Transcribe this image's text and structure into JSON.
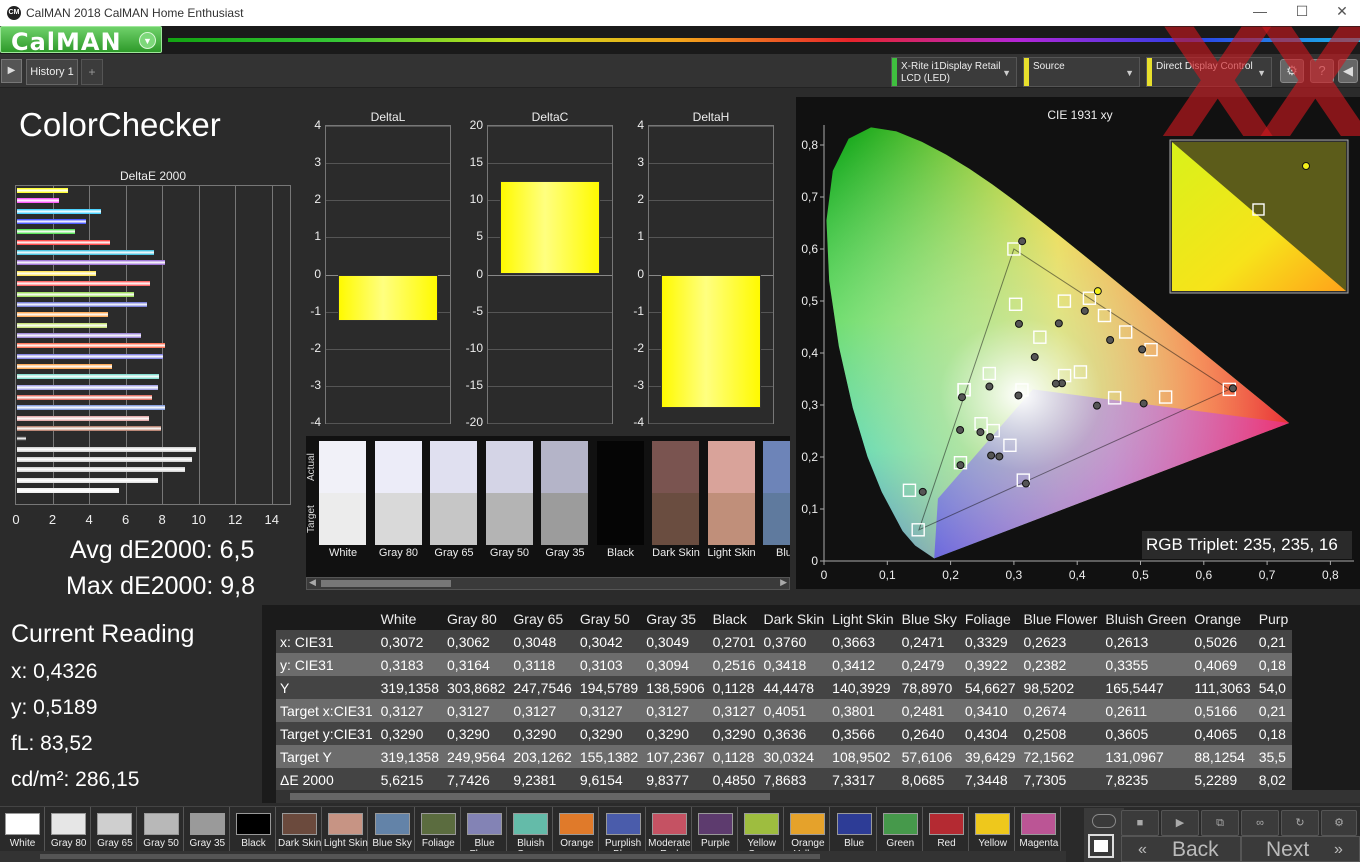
{
  "app": {
    "title": "CalMAN 2018 CalMAN Home Enthusiast",
    "logo": "CalMAN",
    "icon_text": "CM",
    "window_controls": [
      "—",
      "☐",
      "✕"
    ],
    "logo_dropdown_icon": "chevron-down-icon"
  },
  "tabs": {
    "items": [
      "History 1"
    ],
    "add": "+"
  },
  "devices": {
    "meter": {
      "label": "X-Rite i1Display Retail\nLCD (LED)",
      "color": "#3fbf3f"
    },
    "source": {
      "label": "Source",
      "color": "#e8e02c"
    },
    "display": {
      "label": "Direct Display Control",
      "color": "#e8e02c"
    }
  },
  "header_buttons": [
    "?",
    "◀"
  ],
  "watermark": "XX",
  "page_title": "ColorChecker",
  "deltae_chart": {
    "title": "DeltaE 2000",
    "ticks": [
      "0",
      "2",
      "4",
      "6",
      "8",
      "10",
      "12",
      "14"
    ],
    "xlim": [
      0,
      15
    ],
    "bars": [
      {
        "v": 2.8,
        "c": "#ffff00"
      },
      {
        "v": 2.3,
        "c": "#ff33ff"
      },
      {
        "v": 4.6,
        "c": "#22c8ff"
      },
      {
        "v": 3.8,
        "c": "#2233ff"
      },
      {
        "v": 3.2,
        "c": "#33dd33"
      },
      {
        "v": 5.1,
        "c": "#ff2222"
      },
      {
        "v": 7.5,
        "c": "#22b8d8"
      },
      {
        "v": 8.1,
        "c": "#8855cc"
      },
      {
        "v": 4.3,
        "c": "#ffe033"
      },
      {
        "v": 7.3,
        "c": "#ff4444"
      },
      {
        "v": 6.4,
        "c": "#8bd63b"
      },
      {
        "v": 7.1,
        "c": "#5a63d0"
      },
      {
        "v": 5.0,
        "c": "#ff9933"
      },
      {
        "v": 4.9,
        "c": "#b8d85a"
      },
      {
        "v": 6.8,
        "c": "#8a6fd0"
      },
      {
        "v": 8.1,
        "c": "#ff5533"
      },
      {
        "v": 8.0,
        "c": "#6a6ae0"
      },
      {
        "v": 5.2,
        "c": "#ff9a33"
      },
      {
        "v": 7.8,
        "c": "#6ad8c8"
      },
      {
        "v": 7.7,
        "c": "#9090e0"
      },
      {
        "v": 7.4,
        "c": "#dd5544"
      },
      {
        "v": 8.1,
        "c": "#6a8ad8"
      },
      {
        "v": 7.2,
        "c": "#dd9999"
      },
      {
        "v": 7.9,
        "c": "#aa6a55"
      },
      {
        "v": 0.5,
        "c": "#111111"
      },
      {
        "v": 9.8,
        "c": "#cccccc"
      },
      {
        "v": 9.6,
        "c": "#cccccc"
      },
      {
        "v": 9.2,
        "c": "#cccccc"
      },
      {
        "v": 7.7,
        "c": "#dddddd"
      },
      {
        "v": 5.6,
        "c": "#eeeeee"
      }
    ]
  },
  "avg_label": "Avg dE2000: 6,5",
  "max_label": "Max dE2000: 9,8",
  "current_reading": {
    "title": "Current Reading",
    "lines": [
      "x: 0,4326",
      "y: 0,5189",
      "fL: 83,52",
      "cd/m²: 286,15"
    ]
  },
  "delta_charts": [
    {
      "title": "DeltaL",
      "ticks": [
        "4",
        "3",
        "2",
        "1",
        "0",
        "-1",
        "-2",
        "-3",
        "-4"
      ],
      "ylim": [
        -4,
        4
      ],
      "value": -1.25
    },
    {
      "title": "DeltaC",
      "ticks": [
        "20",
        "15",
        "10",
        "5",
        "0",
        "-5",
        "-10",
        "-15",
        "-20"
      ],
      "ylim": [
        -20,
        20
      ],
      "value": 12.6
    },
    {
      "title": "DeltaH",
      "ticks": [
        "4",
        "3",
        "2",
        "1",
        "0",
        "-1",
        "-2",
        "-3",
        "-4"
      ],
      "ylim": [
        -4,
        4
      ],
      "value": -3.6
    }
  ],
  "swatches": {
    "actual_label": "Actual",
    "target_label": "Target",
    "items": [
      {
        "name": "White",
        "a": "#f1f1f8",
        "t": "#ececec"
      },
      {
        "name": "Gray 80",
        "a": "#ececf8",
        "t": "#d9d9d9"
      },
      {
        "name": "Gray 65",
        "a": "#e0e0f0",
        "t": "#c6c6c6"
      },
      {
        "name": "Gray 50",
        "a": "#d4d4e6",
        "t": "#b4b4b4"
      },
      {
        "name": "Gray 35",
        "a": "#b4b4c8",
        "t": "#9c9c9c"
      },
      {
        "name": "Black",
        "a": "#050505",
        "t": "#050505"
      },
      {
        "name": "Dark Skin",
        "a": "#7a5450",
        "t": "#6a4d40"
      },
      {
        "name": "Light Skin",
        "a": "#d9a39a",
        "t": "#c08f7a"
      },
      {
        "name": "Blue",
        "a": "#6d84b8",
        "t": "#5f7a9e"
      }
    ]
  },
  "cie": {
    "title": "CIE 1931 xy",
    "xticks": [
      "0",
      "0,1",
      "0,2",
      "0,3",
      "0,4",
      "0,5",
      "0,6",
      "0,7",
      "0,8"
    ],
    "yticks": [
      "0,8",
      "0,7",
      "0,6",
      "0,5",
      "0,4",
      "0,3",
      "0,2",
      "0,1",
      "0"
    ],
    "triplet": "RGB Triplet: 235, 235, 16",
    "targets": [
      [
        0.3127,
        0.329
      ],
      [
        0.4051,
        0.3636
      ],
      [
        0.3801,
        0.3566
      ],
      [
        0.2481,
        0.264
      ],
      [
        0.341,
        0.4304
      ],
      [
        0.2674,
        0.2508
      ],
      [
        0.2611,
        0.3605
      ],
      [
        0.5166,
        0.4065
      ],
      [
        0.2156,
        0.189
      ],
      [
        0.4591,
        0.3137
      ],
      [
        0.3148,
        0.1556
      ],
      [
        0.3798,
        0.4998
      ],
      [
        0.4766,
        0.4404
      ],
      [
        0.1488,
        0.06
      ],
      [
        0.3027,
        0.4937
      ],
      [
        0.5397,
        0.3153
      ],
      [
        0.4431,
        0.4721
      ],
      [
        0.2937,
        0.2225
      ],
      [
        0.2215,
        0.3295
      ],
      [
        0.6403,
        0.33
      ],
      [
        0.3,
        0.6
      ],
      [
        0.4193,
        0.5053
      ],
      [
        0.2211,
        0.3291
      ],
      [
        0.135,
        0.136
      ]
    ],
    "measured": [
      [
        0.3072,
        0.3183
      ],
      [
        0.376,
        0.3418
      ],
      [
        0.3663,
        0.3412
      ],
      [
        0.2471,
        0.2479
      ],
      [
        0.3329,
        0.3922
      ],
      [
        0.2623,
        0.2382
      ],
      [
        0.2613,
        0.3355
      ],
      [
        0.5026,
        0.4069
      ],
      [
        0.2156,
        0.1844
      ],
      [
        0.4312,
        0.2987
      ],
      [
        0.319,
        0.149
      ],
      [
        0.371,
        0.457
      ],
      [
        0.452,
        0.425
      ],
      [
        0.156,
        0.133
      ],
      [
        0.308,
        0.456
      ],
      [
        0.505,
        0.303
      ],
      [
        0.4326,
        0.5189
      ],
      [
        0.277,
        0.201
      ],
      [
        0.218,
        0.315
      ],
      [
        0.646,
        0.332
      ],
      [
        0.313,
        0.615
      ],
      [
        0.412,
        0.481
      ],
      [
        0.215,
        0.252
      ],
      [
        0.264,
        0.203
      ]
    ]
  },
  "table": {
    "columns": [
      "",
      "White",
      "Gray 80",
      "Gray 65",
      "Gray 50",
      "Gray 35",
      "Black",
      "Dark Skin",
      "Light Skin",
      "Blue Sky",
      "Foliage",
      "Blue Flower",
      "Bluish Green",
      "Orange",
      "Purp"
    ],
    "rows": [
      [
        "x: CIE31",
        "0,3072",
        "0,3062",
        "0,3048",
        "0,3042",
        "0,3049",
        "0,2701",
        "0,3760",
        "0,3663",
        "0,2471",
        "0,3329",
        "0,2623",
        "0,2613",
        "0,5026",
        "0,21"
      ],
      [
        "y: CIE31",
        "0,3183",
        "0,3164",
        "0,3118",
        "0,3103",
        "0,3094",
        "0,2516",
        "0,3418",
        "0,3412",
        "0,2479",
        "0,3922",
        "0,2382",
        "0,3355",
        "0,4069",
        "0,18"
      ],
      [
        "Y",
        "319,1358",
        "303,8682",
        "247,7546",
        "194,5789",
        "138,5906",
        "0,1128",
        "44,4478",
        "140,3929",
        "78,8970",
        "54,6627",
        "98,5202",
        "165,5447",
        "111,3063",
        "54,0"
      ],
      [
        "Target x:CIE31",
        "0,3127",
        "0,3127",
        "0,3127",
        "0,3127",
        "0,3127",
        "0,3127",
        "0,4051",
        "0,3801",
        "0,2481",
        "0,3410",
        "0,2674",
        "0,2611",
        "0,5166",
        "0,21"
      ],
      [
        "Target y:CIE31",
        "0,3290",
        "0,3290",
        "0,3290",
        "0,3290",
        "0,3290",
        "0,3290",
        "0,3636",
        "0,3566",
        "0,2640",
        "0,4304",
        "0,2508",
        "0,3605",
        "0,4065",
        "0,18"
      ],
      [
        "Target Y",
        "319,1358",
        "249,9564",
        "203,1262",
        "155,1382",
        "107,2367",
        "0,1128",
        "30,0324",
        "108,9502",
        "57,6106",
        "39,6429",
        "72,1562",
        "131,0967",
        "88,1254",
        "35,5"
      ],
      [
        "ΔE 2000",
        "5,6215",
        "7,7426",
        "9,2381",
        "9,6154",
        "9,8377",
        "0,4850",
        "7,8683",
        "7,3317",
        "8,0685",
        "7,3448",
        "7,7305",
        "7,8235",
        "5,2289",
        "8,02"
      ]
    ]
  },
  "bottom_swatches": [
    {
      "label": "White",
      "c": "#ffffff"
    },
    {
      "label": "Gray 80",
      "c": "#e6e6e6"
    },
    {
      "label": "Gray 65",
      "c": "#cfcfcf"
    },
    {
      "label": "Gray 50",
      "c": "#b8b8b8"
    },
    {
      "label": "Gray 35",
      "c": "#9a9a9a"
    },
    {
      "label": "Black",
      "c": "#000000"
    },
    {
      "label": "Dark Skin",
      "c": "#6b4a3d"
    },
    {
      "label": "Light Skin",
      "c": "#c79484"
    },
    {
      "label": "Blue Sky",
      "c": "#6383a8"
    },
    {
      "label": "Foliage",
      "c": "#5b6c3f"
    },
    {
      "label": "Blue\nFlower",
      "c": "#8383b5"
    },
    {
      "label": "Bluish\nGreen",
      "c": "#64bba9"
    },
    {
      "label": "Orange",
      "c": "#e07a2a"
    },
    {
      "label": "Purplish\nBlue",
      "c": "#4a5cab"
    },
    {
      "label": "Moderate\nRed",
      "c": "#c55263"
    },
    {
      "label": "Purple",
      "c": "#5d3b6e"
    },
    {
      "label": "Yellow\nGreen",
      "c": "#9ebd3f"
    },
    {
      "label": "Orange\nYellow",
      "c": "#e5a22b"
    },
    {
      "label": "Blue",
      "c": "#2d3c96"
    },
    {
      "label": "Green",
      "c": "#46994b"
    },
    {
      "label": "Red",
      "c": "#b42a32"
    },
    {
      "label": "Yellow",
      "c": "#eec81c"
    },
    {
      "label": "Magenta",
      "c": "#bb5595"
    }
  ],
  "controls": {
    "back": "Back",
    "next": "Next",
    "icons": [
      "stop-icon",
      "play-icon",
      "fit-icon",
      "loop-icon",
      "refresh-icon",
      "settings-icon"
    ]
  }
}
